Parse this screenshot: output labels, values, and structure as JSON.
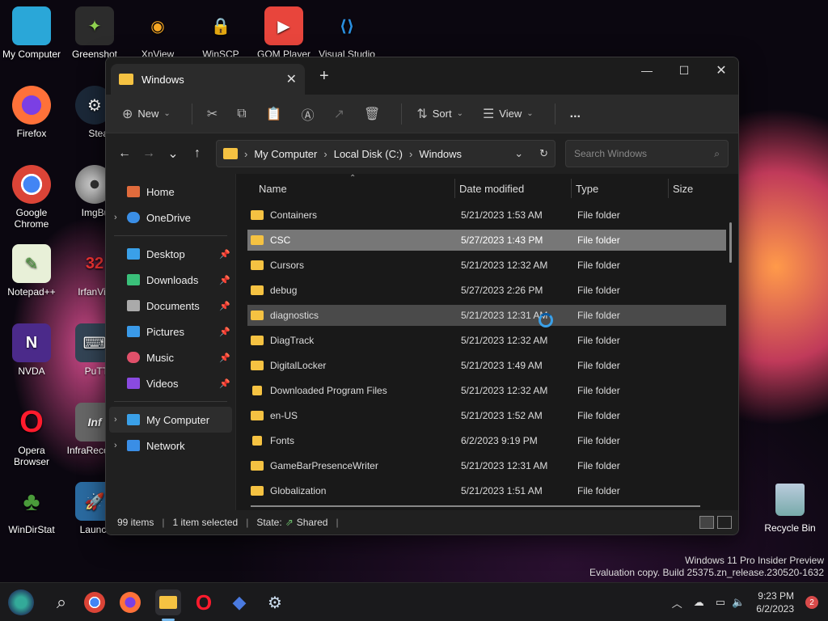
{
  "desktop": {
    "icons": [
      {
        "label": "My Computer"
      },
      {
        "label": "Greenshot"
      },
      {
        "label": "XnView"
      },
      {
        "label": "WinSCP"
      },
      {
        "label": "GOM Player"
      },
      {
        "label": "Visual Studio"
      },
      {
        "label": "Firefox"
      },
      {
        "label": "Steam"
      },
      {
        "label": "Google Chrome"
      },
      {
        "label": "ImgBurn"
      },
      {
        "label": "Notepad++"
      },
      {
        "label": "IrfanView"
      },
      {
        "label": "NVDA"
      },
      {
        "label": "PuTTY"
      },
      {
        "label": "Opera Browser"
      },
      {
        "label": "InfraRecorder"
      },
      {
        "label": "WinDirStat"
      },
      {
        "label": "Launchy"
      }
    ],
    "recycle_bin": "Recycle Bin",
    "watermark_line1": "Windows 11 Pro Insider Preview",
    "watermark_line2": "Evaluation copy. Build 25375.zn_release.230520-1632"
  },
  "window": {
    "tab_title": "Windows",
    "toolbar": {
      "new_label": "New",
      "sort_label": "Sort",
      "view_label": "View",
      "more_label": "..."
    },
    "address": {
      "crumbs": [
        "My Computer",
        "Local Disk (C:)",
        "Windows"
      ],
      "search_placeholder": "Search Windows"
    },
    "sidebar": {
      "home": "Home",
      "onedrive": "OneDrive",
      "pinned": [
        "Desktop",
        "Downloads",
        "Documents",
        "Pictures",
        "Music",
        "Videos"
      ],
      "my_computer": "My Computer",
      "network": "Network"
    },
    "columns": {
      "name": "Name",
      "date": "Date modified",
      "type": "Type",
      "size": "Size"
    },
    "files": [
      {
        "name": "Containers",
        "date": "5/21/2023 1:53 AM",
        "type": "File folder"
      },
      {
        "name": "CSC",
        "date": "5/27/2023 1:43 PM",
        "type": "File folder"
      },
      {
        "name": "Cursors",
        "date": "5/21/2023 12:32 AM",
        "type": "File folder"
      },
      {
        "name": "debug",
        "date": "5/27/2023 2:26 PM",
        "type": "File folder"
      },
      {
        "name": "diagnostics",
        "date": "5/21/2023 12:31 AM",
        "type": "File folder"
      },
      {
        "name": "DiagTrack",
        "date": "5/21/2023 12:32 AM",
        "type": "File folder"
      },
      {
        "name": "DigitalLocker",
        "date": "5/21/2023 1:49 AM",
        "type": "File folder"
      },
      {
        "name": "Downloaded Program Files",
        "date": "5/21/2023 12:32 AM",
        "type": "File folder"
      },
      {
        "name": "en-US",
        "date": "5/21/2023 1:52 AM",
        "type": "File folder"
      },
      {
        "name": "Fonts",
        "date": "6/2/2023 9:19 PM",
        "type": "File folder"
      },
      {
        "name": "GameBarPresenceWriter",
        "date": "5/21/2023 12:31 AM",
        "type": "File folder"
      },
      {
        "name": "Globalization",
        "date": "5/21/2023 1:51 AM",
        "type": "File folder"
      }
    ],
    "status": {
      "items": "99 items",
      "selected": "1 item selected",
      "state": "State:",
      "shared": "Shared"
    }
  },
  "taskbar": {
    "time": "9:23 PM",
    "date": "6/2/2023",
    "notifications": "2"
  }
}
